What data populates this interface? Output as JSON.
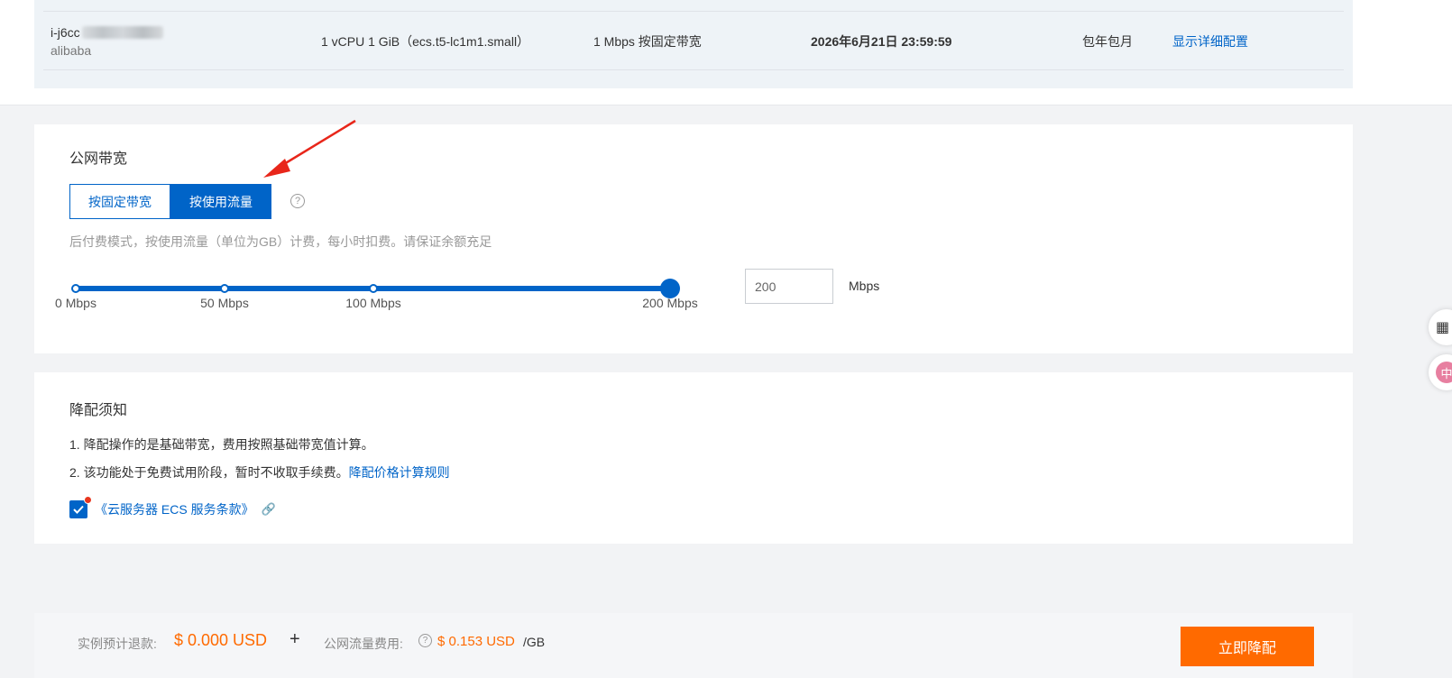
{
  "instance": {
    "id_prefix": "i-j6cc",
    "owner": "alibaba",
    "spec": "1 vCPU 1 GiB（ecs.t5-lc1m1.small）",
    "bandwidth": "1 Mbps 按固定带宽",
    "expire": "2026年6月21日 23:59:59",
    "billing": "包年包月",
    "detail_link": "显示详细配置"
  },
  "bandwidth_section": {
    "title": "公网带宽",
    "options": [
      "按固定带宽",
      "按使用流量"
    ],
    "selected_option": "按使用流量",
    "hint": "后付费模式，按使用流量（单位为GB）计费，每小时扣费。请保证余额充足",
    "slider": {
      "marks": [
        "0 Mbps",
        "50 Mbps",
        "100 Mbps",
        "200 Mbps"
      ],
      "value_mbps": 200
    },
    "input_value": "200",
    "unit": "Mbps"
  },
  "notice": {
    "title": "降配须知",
    "line1": "1. 降配操作的是基础带宽，费用按照基础带宽值计算。",
    "line2": "2. 该功能处于免费试用阶段，暂时不收取手续费。",
    "line2_link": "降配价格计算规则",
    "terms_link": "《云服务器 ECS 服务条款》",
    "terms_checked": true
  },
  "footer": {
    "refund_label": "实例预计退款:",
    "refund_amount": "$ 0.000 USD",
    "plus": "+",
    "traffic_label": "公网流量费用:",
    "traffic_amount": "$ 0.153 USD",
    "traffic_unit": "/GB",
    "submit": "立即降配"
  },
  "side": {
    "lang_char": "中"
  },
  "colors": {
    "primary": "#0064c8",
    "accent": "#ff6a00",
    "annotation_arrow": "#e8261a"
  }
}
